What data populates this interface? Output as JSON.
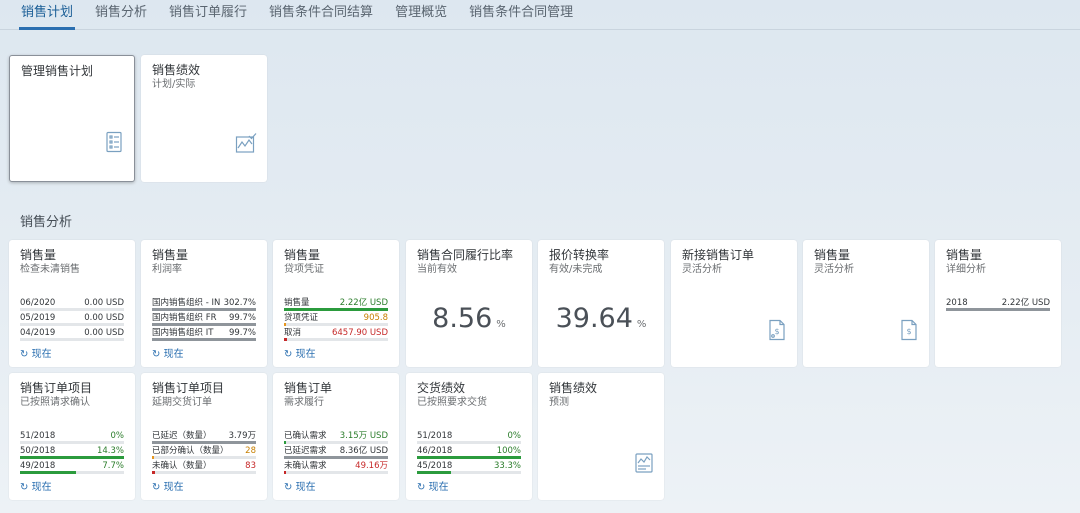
{
  "nav": {
    "tabs": [
      "销售计划",
      "销售分析",
      "销售订单履行",
      "销售条件合同结算",
      "管理概览",
      "销售条件合同管理"
    ]
  },
  "section": {
    "title": "销售分析"
  },
  "refresh_label": "现在",
  "tiles": {
    "manage_plan": {
      "title": "管理销售计划"
    },
    "perf_plan": {
      "title": "销售绩效",
      "sub": "计划/实际"
    },
    "sales_unclear": {
      "title": "销售量",
      "sub": "检查未清销售",
      "rows": [
        {
          "label": "06/2020",
          "value": "0.00 USD",
          "fill": 0
        },
        {
          "label": "05/2019",
          "value": "0.00 USD",
          "fill": 0
        },
        {
          "label": "04/2019",
          "value": "0.00 USD",
          "fill": 0
        }
      ]
    },
    "sales_margin": {
      "title": "销售量",
      "sub": "利润率",
      "rows": [
        {
          "label": "国内销售组织 - IN",
          "value": "302.7%",
          "fill": 100
        },
        {
          "label": "国内销售组织 FR",
          "value": "99.7%",
          "fill": 100
        },
        {
          "label": "国内销售组织 IT",
          "value": "99.7%",
          "fill": 100
        }
      ]
    },
    "sales_credit": {
      "title": "销售量",
      "sub": "贷项凭证",
      "rows": [
        {
          "label": "销售量",
          "value": "2.22亿 USD",
          "fill": 100
        },
        {
          "label": "贷项凭证",
          "value": "905.8",
          "fill": 2
        },
        {
          "label": "取消",
          "value": "6457.90 USD",
          "fill": 3
        }
      ]
    },
    "contract_ratio": {
      "title": "销售合同履行比率",
      "sub": "当前有效",
      "value": "8.56",
      "unit": "%"
    },
    "quote_conv": {
      "title": "报价转换率",
      "sub": "有效/未完成",
      "value": "39.64",
      "unit": "%"
    },
    "new_orders": {
      "title": "新接销售订单",
      "sub": "灵活分析"
    },
    "sales_flex": {
      "title": "销售量",
      "sub": "灵活分析"
    },
    "sales_detail": {
      "title": "销售量",
      "sub": "详细分析",
      "rows": [
        {
          "label": "2018",
          "value": "2.22亿 USD",
          "fill": 100
        }
      ]
    },
    "order_items_confirm": {
      "title": "销售订单项目",
      "sub": "已按照请求确认",
      "rows": [
        {
          "label": "51/2018",
          "value": "0%",
          "fill": 0
        },
        {
          "label": "50/2018",
          "value": "14.3%",
          "fill": 100
        },
        {
          "label": "49/2018",
          "value": "7.7%",
          "fill": 54
        }
      ]
    },
    "order_items_delay": {
      "title": "销售订单项目",
      "sub": "延期交货订单",
      "rows": [
        {
          "label": "已延迟（数量）",
          "value": "3.79万",
          "fill": 100
        },
        {
          "label": "已部分确认（数量）",
          "value": "28",
          "fill": 2
        },
        {
          "label": "未确认（数量）",
          "value": "83",
          "fill": 3
        }
      ]
    },
    "orders_fulfill": {
      "title": "销售订单",
      "sub": "需求履行",
      "rows": [
        {
          "label": "已确认需求",
          "value": "3.15万 USD",
          "fill": 2
        },
        {
          "label": "已延迟需求",
          "value": "8.36亿 USD",
          "fill": 100
        },
        {
          "label": "未确认需求",
          "value": "49.16万",
          "fill": 2
        }
      ]
    },
    "delivery_perf": {
      "title": "交货绩效",
      "sub": "已按照要求交货",
      "rows": [
        {
          "label": "51/2018",
          "value": "0%",
          "fill": 0
        },
        {
          "label": "46/2018",
          "value": "100%",
          "fill": 100
        },
        {
          "label": "45/2018",
          "value": "33.3%",
          "fill": 33
        }
      ]
    },
    "perf_forecast": {
      "title": "销售绩效",
      "sub": "预测"
    }
  },
  "colors": {
    "accent": "#2b6fb0",
    "green": "#2b9b3d",
    "orange": "#e6961e",
    "red": "#c62828",
    "gray": "#8f959b"
  }
}
